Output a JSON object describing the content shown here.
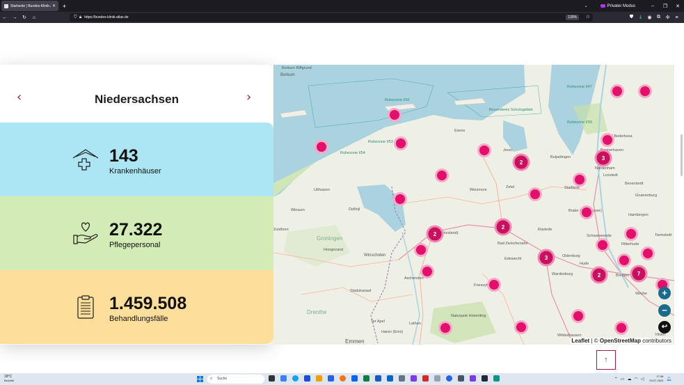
{
  "browser": {
    "tab_title": "Startseite | Bundes-Klinik-Atlas",
    "new_tab": "+",
    "private_label": "Privater Modus",
    "url": "https://bundes-klinik-atlas.de",
    "zoom": "130%"
  },
  "panel": {
    "state_name": "Niedersachsen",
    "prev_arrow": "‹",
    "next_arrow": "›",
    "stats": [
      {
        "value": "143",
        "label": "Krankenhäuser",
        "icon": "hospital-house-icon"
      },
      {
        "value": "27.322",
        "label": "Pflegepersonal",
        "icon": "heart-hand-icon"
      },
      {
        "value": "1.459.508",
        "label": "Behandlungsfälle",
        "icon": "clipboard-icon"
      }
    ]
  },
  "map": {
    "attribution_leaflet": "Leaflet",
    "attribution_sep": " | © ",
    "attribution_osm": "OpenStreetMap",
    "attribution_tail": " contributors",
    "zoom_in": "+",
    "zoom_out": "−",
    "reset": "↩",
    "labels": [
      "Borkum Riffgrund",
      "Borkum",
      "Ruhezone I/52",
      "Besonderes Schutzgebiet",
      "Ruhezone I/53",
      "Ruhezone I/54",
      "Ruhezone I/47",
      "Ruhezone I/39",
      "Bad Bederkesa",
      "Esens",
      "Jever",
      "Butjadingen",
      "Nordenham",
      "Bremerhaven",
      "Loxstedt",
      "Stadland",
      "Beverstedt",
      "Gnarrenburg",
      "Uithuizen",
      "Delfzijl",
      "Wiesmoor",
      "Zetel",
      "Brake (Unterweser)",
      "Winsum",
      "Zuidhorn",
      "Groningen",
      "Hoogezand",
      "Leer (Ostfriesland)",
      "Bad Zwischenahn",
      "Schwanewede",
      "Rastede",
      "Hambergen",
      "Ritterhude",
      "Edewecht",
      "Oldenburg",
      "Winschoten",
      "Aschendorf",
      "Wardenburg",
      "Hude",
      "Bremen",
      "Tarmstedt",
      "Stadskanaal",
      "Friesoythe",
      "Wildeshausen",
      "Weyhe",
      "Drenthe",
      "Naturpark Hümmling",
      "Ter Apel",
      "Lathen",
      "Emmen",
      "Haren (Ems)",
      "Vilsen"
    ],
    "cluster_counts": [
      "2",
      "3",
      "2",
      "2",
      "3",
      "2",
      "7"
    ]
  },
  "page": {
    "to_top": "↑"
  },
  "taskbar": {
    "temperature": "18°C",
    "weather": "Bewölkt",
    "search_placeholder": "Suche",
    "time": "17:48",
    "date": "03.07.2024"
  }
}
